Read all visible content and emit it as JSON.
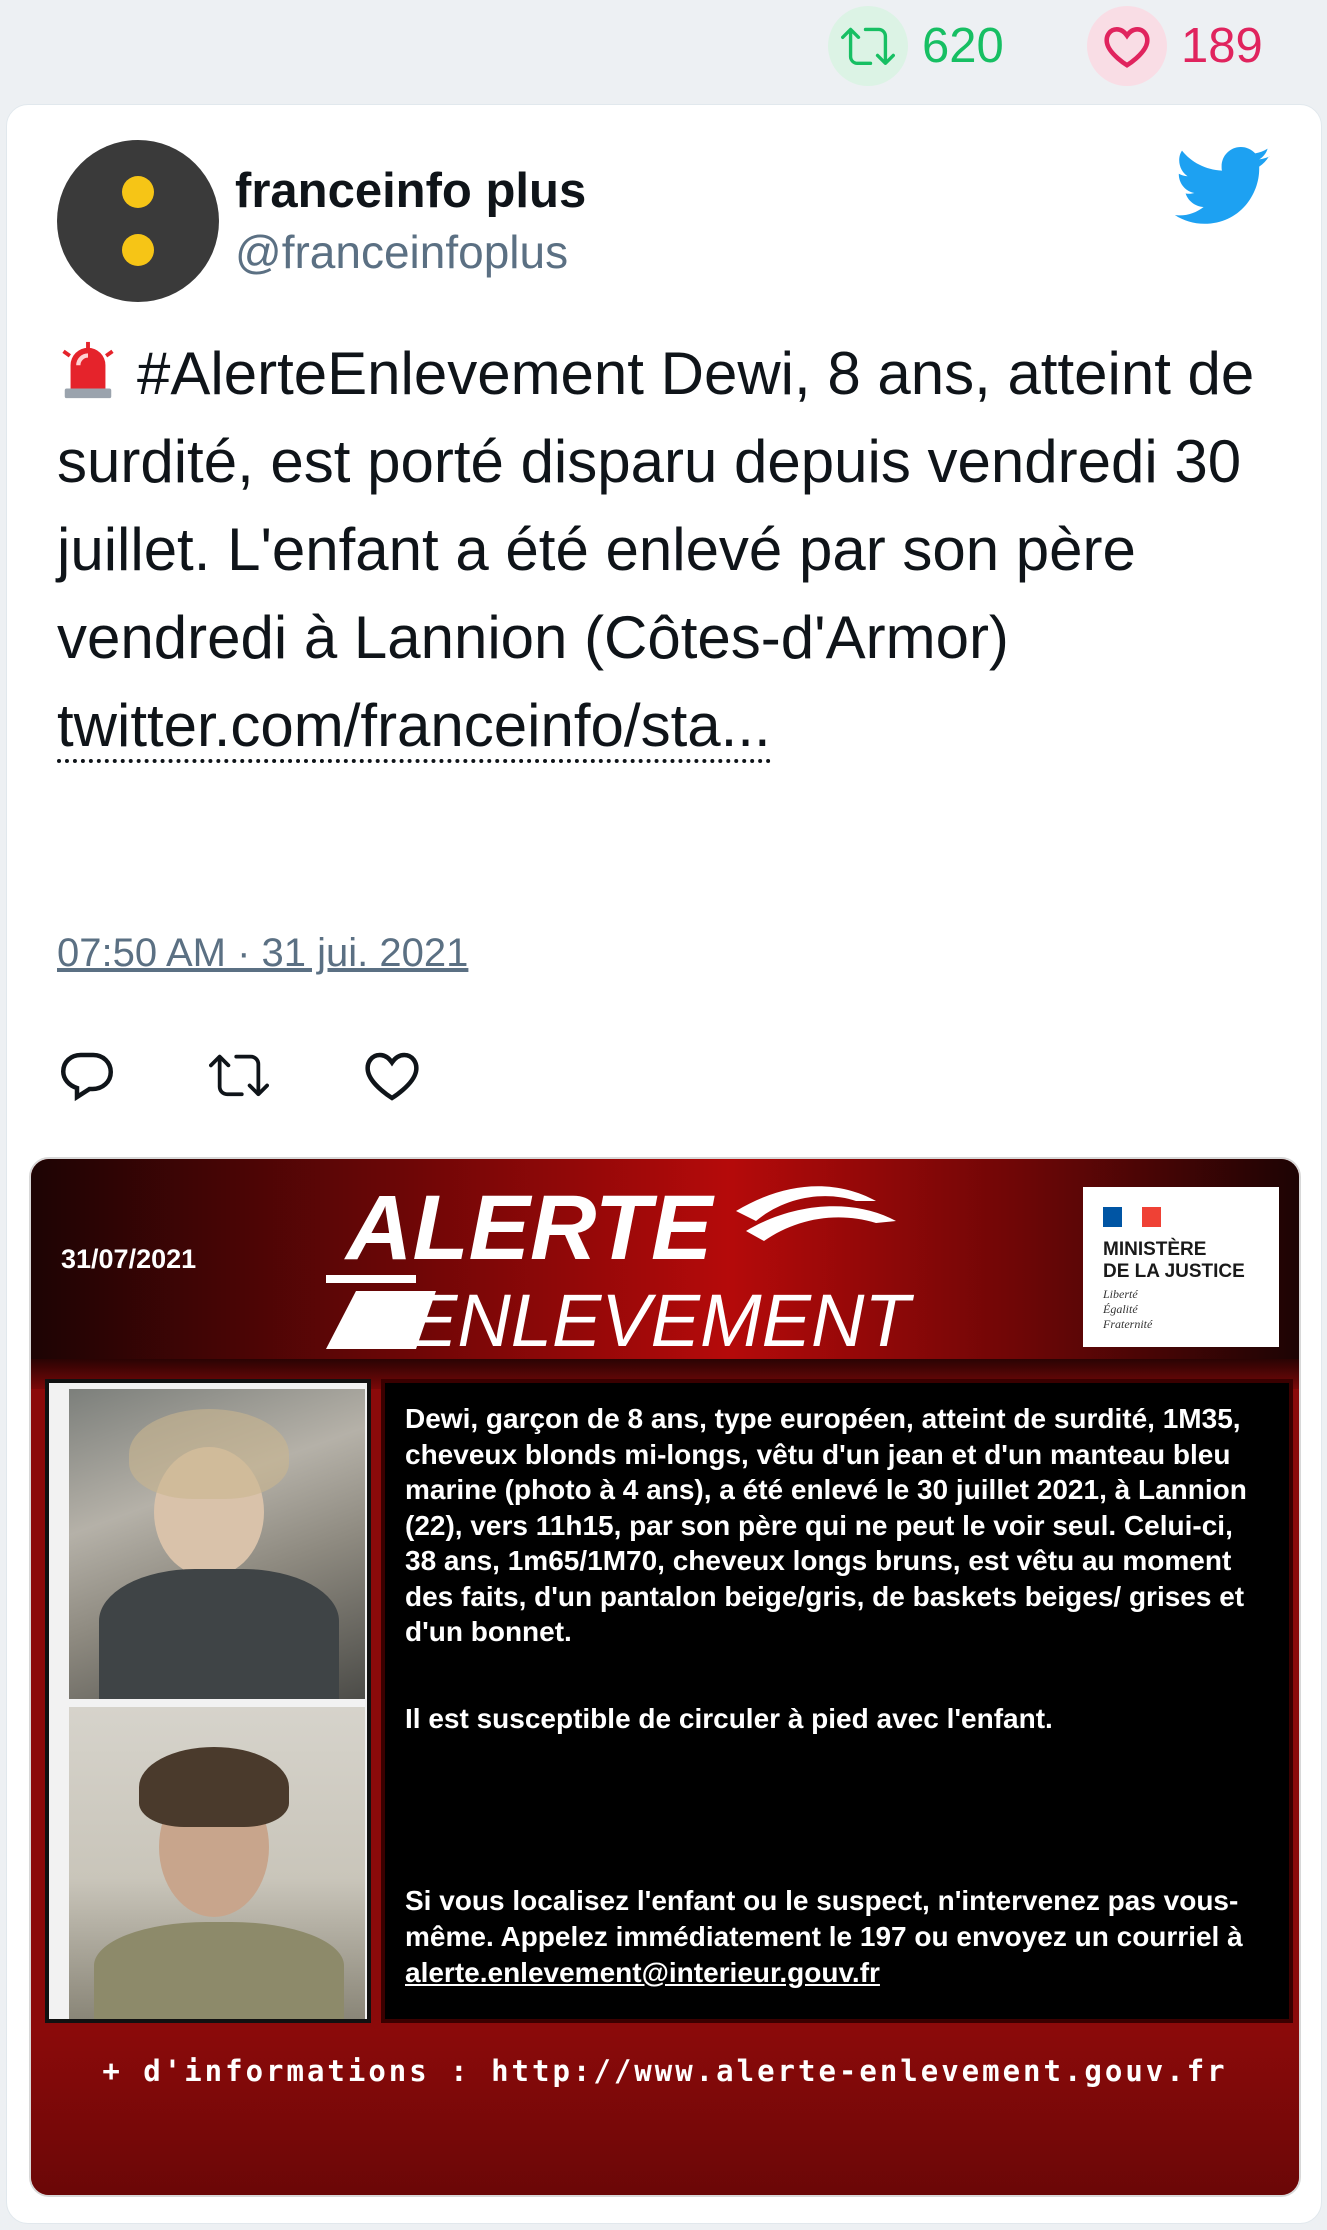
{
  "stats": {
    "retweets": "620",
    "likes": "189"
  },
  "author": {
    "name": "franceinfo plus",
    "handle": "@franceinfoplus"
  },
  "tweet": {
    "text": "#AlerteEnlevement Dewi, 8 ans, atteint de surdité, est porté disparu depuis vendredi 30 juillet. L'enfant a été enlevé par son père vendredi à Lannion (Côtes-d'Armor)",
    "link": "twitter.com/franceinfo/sta...",
    "timestamp": "07:50 AM · 31 jui. 2021"
  },
  "icons": {
    "retweet": "retweet-icon",
    "like": "heart-icon",
    "reply": "reply-icon",
    "platform": "twitter-bird-icon",
    "emoji": "police-siren-icon"
  },
  "poster": {
    "date": "31/07/2021",
    "title_line1": "ALERTE",
    "title_line2": "ENLEVEMENT",
    "ministry_line1": "MINISTÈRE",
    "ministry_line2": "DE LA JUSTICE",
    "motto_1": "Liberté",
    "motto_2": "Égalité",
    "motto_3": "Fraternité",
    "description": "Dewi, garçon de 8 ans, type européen, atteint de surdité, 1M35, cheveux blonds mi-longs, vêtu d'un jean et d'un manteau bleu marine (photo à 4 ans), a été enlevé le 30 juillet 2021, à Lannion (22), vers 11h15, par son père qui ne peut le voir seul. Celui-ci, 38 ans, 1m65/1M70, cheveux longs bruns, est vêtu au moment des faits, d'un pantalon beige/gris, de baskets beiges/ grises et d'un bonnet.",
    "note": "Il est susceptible de circuler à pied avec l'enfant.",
    "instruction": "Si vous localisez l'enfant ou le suspect, n'intervenez pas vous-même. Appelez immédiatement le 197 ou envoyez un courriel à",
    "email": "alerte.enlevement@interieur.gouv.fr",
    "footer": "+ d'informations : http://www.alerte-enlevement.gouv.fr"
  },
  "colors": {
    "retweet_green": "#17bf63",
    "like_red": "#e0245e",
    "twitter_blue": "#1da1f2",
    "poster_red": "#b50a0a"
  }
}
